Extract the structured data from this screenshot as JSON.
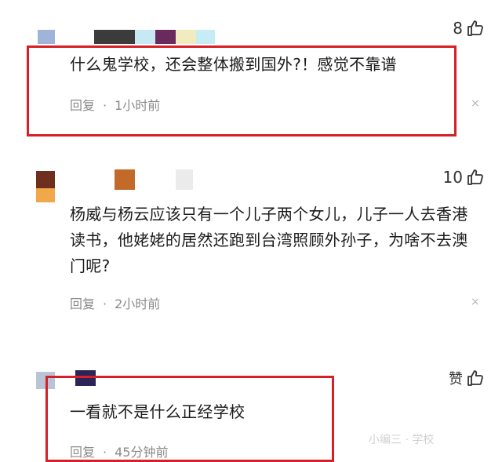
{
  "comments": [
    {
      "text": "什么鬼学校，还会整体搬到国外?！感觉不靠谱",
      "reply_label": "回复",
      "separator": "·",
      "time": "1小时前",
      "likes": "8",
      "close": "×",
      "avatar_colors": [
        "#9fb4d8",
        "#3b3b3b",
        "#c7e9f3",
        "#6b2a5e",
        "#f0ecbf",
        "#c6ecf6"
      ]
    },
    {
      "text": "杨威与杨云应该只有一个儿子两个女儿，儿子一人去香港读书，他姥姥的居然还跑到台湾照顾外孙子，为啥不去澳门呢?",
      "reply_label": "回复",
      "separator": "·",
      "time": "2小时前",
      "likes": "10",
      "close": "×",
      "avatar_colors": [
        "#6e2f1f",
        "#f0a84a",
        "#c26a2a",
        "#ebebeb"
      ]
    },
    {
      "text": "一看就不是什么正经学校",
      "reply_label": "回复",
      "separator": "·",
      "time": "45分钟前",
      "likes": "赞",
      "close": "×",
      "avatar_colors": [
        "#b7c5d7",
        "#2c2356"
      ]
    }
  ],
  "watermark": "小编三 · 学校"
}
